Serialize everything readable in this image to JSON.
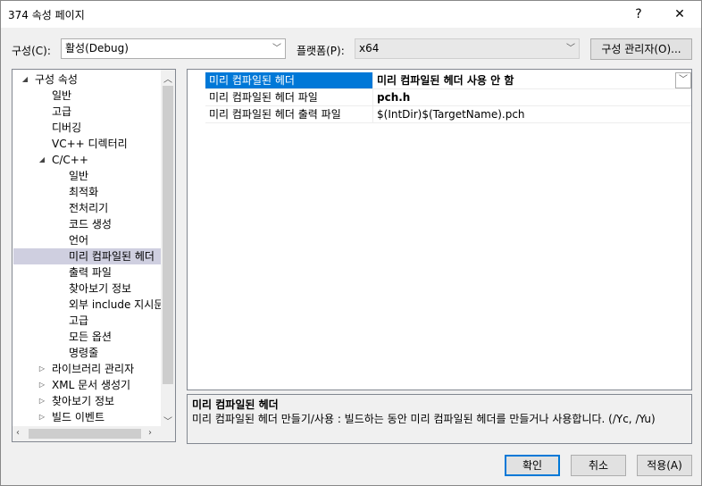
{
  "window": {
    "title": "374 속성 페이지",
    "help_label": "?",
    "close_label": "✕"
  },
  "toolbar": {
    "config_label": "구성(C):",
    "config_value": "활성(Debug)",
    "platform_label": "플랫폼(P):",
    "platform_value": "x64",
    "config_manager_label": "구성 관리자(O)..."
  },
  "tree": {
    "items": [
      {
        "label": "구성 속성",
        "expander": "◢"
      },
      {
        "label": "일반"
      },
      {
        "label": "고급"
      },
      {
        "label": "디버깅"
      },
      {
        "label": "VC++ 디렉터리"
      },
      {
        "label": "C/C++",
        "expander": "◢"
      },
      {
        "label": "일반"
      },
      {
        "label": "최적화"
      },
      {
        "label": "전처리기"
      },
      {
        "label": "코드 생성"
      },
      {
        "label": "언어"
      },
      {
        "label": "미리 컴파일된 헤더",
        "selected": true
      },
      {
        "label": "출력 파일"
      },
      {
        "label": "찾아보기 정보"
      },
      {
        "label": "외부 include 지시문"
      },
      {
        "label": "고급"
      },
      {
        "label": "모든 옵션"
      },
      {
        "label": "명령줄"
      },
      {
        "label": "라이브러리 관리자",
        "expander": "▷"
      },
      {
        "label": "XML 문서 생성기",
        "expander": "▷"
      },
      {
        "label": "찾아보기 정보",
        "expander": "▷"
      },
      {
        "label": "빌드 이벤트",
        "expander": "▷"
      }
    ]
  },
  "grid": {
    "rows": [
      {
        "name": "미리 컴파일된 헤더",
        "value": "미리 컴파일된 헤더 사용 안 함"
      },
      {
        "name": "미리 컴파일된 헤더 파일",
        "value": "pch.h"
      },
      {
        "name": "미리 컴파일된 헤더 출력 파일",
        "value": "$(IntDir)$(TargetName).pch"
      }
    ]
  },
  "description": {
    "title": "미리 컴파일된 헤더",
    "text": "미리 컴파일된 헤더 만들기/사용 : 빌드하는 동안 미리 컴파일된 헤더를 만들거나 사용합니다.     (/Yc, /Yu)"
  },
  "buttons": {
    "ok": "확인",
    "cancel": "취소",
    "apply": "적용(A)"
  }
}
